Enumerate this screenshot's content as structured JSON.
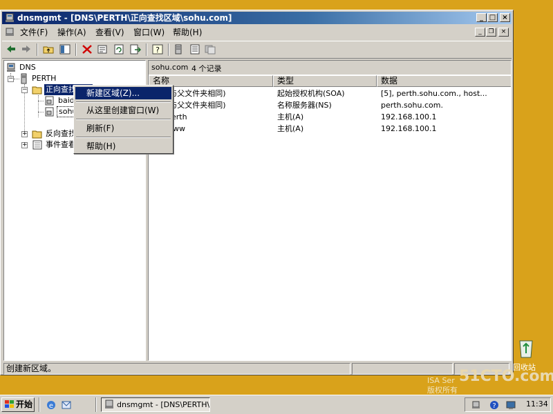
{
  "window": {
    "title": "dnsmgmt - [DNS\\PERTH\\正向查找区域\\sohu.com]",
    "caption_buttons": [
      "_",
      "□",
      "×"
    ]
  },
  "menu": {
    "items": [
      "文件(F)",
      "操作(A)",
      "查看(V)",
      "窗口(W)",
      "帮助(H)"
    ]
  },
  "toolbar": {
    "icons": [
      "back-icon",
      "forward-icon",
      "up-folder-icon",
      "show-hide-tree-icon",
      "delete-icon",
      "properties-icon",
      "refresh-icon",
      "export-list-icon",
      "help-icon",
      "new-record-icon",
      "list-icon",
      "detail-icon"
    ]
  },
  "tree": {
    "root": "DNS",
    "server": "PERTH",
    "forward_zone": "正向查找区域",
    "zone1": "baidu",
    "zone2": "sohu",
    "reverse_zone": "反向查找",
    "event_viewer": "事件查看"
  },
  "detail": {
    "header_zone": "sohu.com",
    "header_count": "4 个记录",
    "columns": [
      "名称",
      "类型",
      "数据"
    ],
    "rows": [
      {
        "name": "(与父文件夹相同)",
        "type": "起始授权机构(SOA)",
        "data": "[5], perth.sohu.com., host..."
      },
      {
        "name": "(与父文件夹相同)",
        "type": "名称服务器(NS)",
        "data": "perth.sohu.com."
      },
      {
        "name": "perth",
        "type": "主机(A)",
        "data": "192.168.100.1"
      },
      {
        "name": "www",
        "type": "主机(A)",
        "data": "192.168.100.1"
      }
    ]
  },
  "context_menu": {
    "items": [
      "新建区域(Z)...",
      "从这里创建窗口(W)",
      "刷新(F)",
      "帮助(H)"
    ]
  },
  "status": {
    "text": "创建新区域。"
  },
  "desktop": {
    "recycle_bin": "回收站",
    "watermark": "51CTO.com",
    "isa_text": "ISA Ser",
    "isa_text2": "版权所有"
  },
  "taskbar": {
    "start": "开始",
    "task": "dnsmgmt - [DNS\\PERTH\\...",
    "clock": "11:34"
  },
  "colors": {
    "desktop": "#D9A21B",
    "title_active": "#0A246A",
    "selection": "#0A246A",
    "face": "#D4D0C8"
  }
}
